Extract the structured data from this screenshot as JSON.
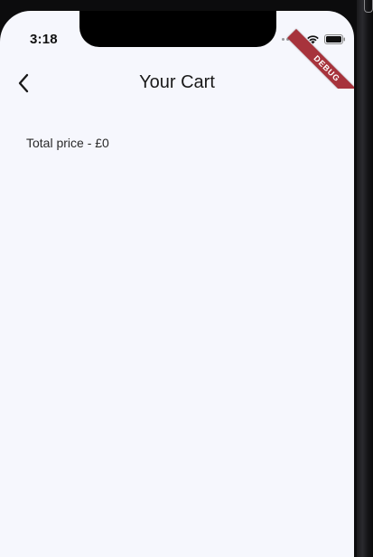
{
  "status_bar": {
    "time": "3:18",
    "icons": [
      "signal-dots-icon",
      "wifi-icon",
      "battery-icon"
    ]
  },
  "debug_banner": {
    "label": "DEBUG",
    "color": "#a7333c"
  },
  "nav": {
    "back_icon": "chevron-left-icon",
    "title": "Your Cart"
  },
  "cart": {
    "total_price_text": "Total price - £0"
  },
  "colors": {
    "background": "#f6f7fd",
    "text": "#1a1a1a"
  }
}
